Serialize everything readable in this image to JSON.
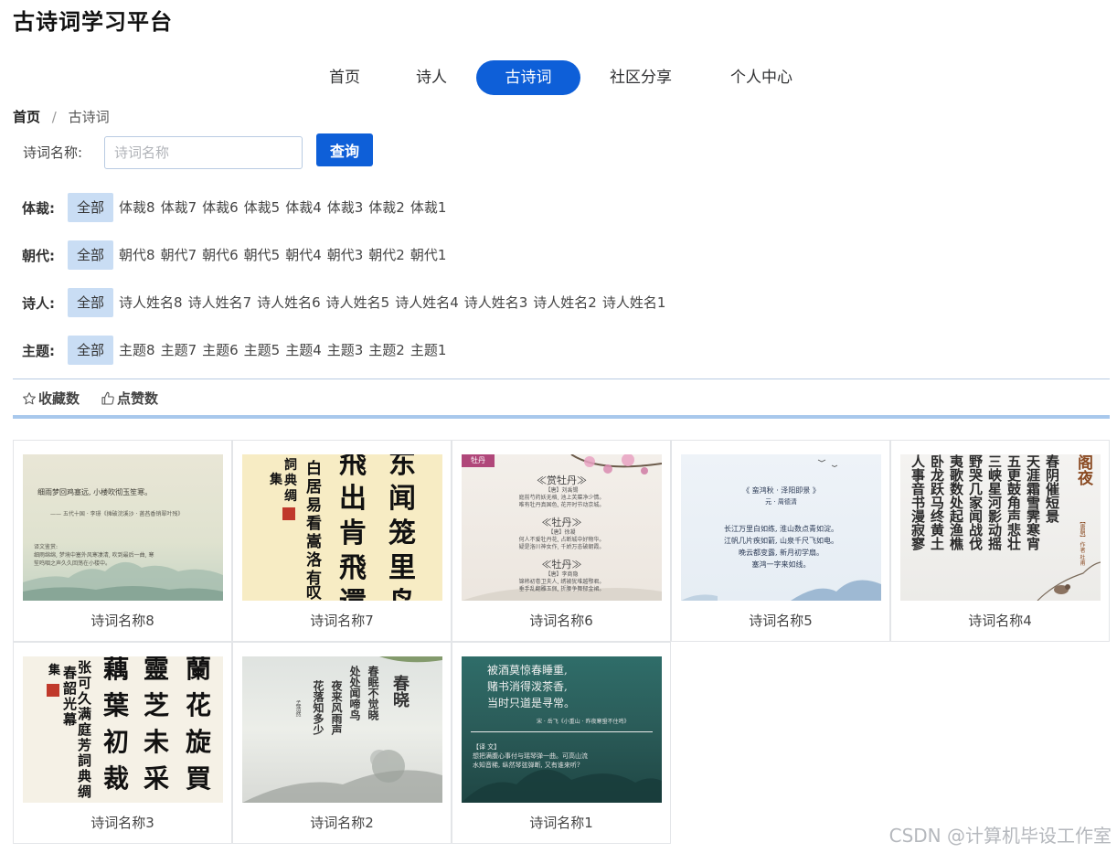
{
  "site": {
    "title": "古诗词学习平台"
  },
  "nav": {
    "items": [
      "首页",
      "诗人",
      "古诗词",
      "社区分享",
      "个人中心"
    ],
    "active_index": 2
  },
  "breadcrumb": {
    "home": "首页",
    "separator": "/",
    "current": "古诗词"
  },
  "search": {
    "label": "诗词名称:",
    "placeholder": "诗词名称",
    "value": "",
    "button": "查询"
  },
  "filters": [
    {
      "label": "体裁:",
      "options": [
        "全部",
        "体裁8",
        "体裁7",
        "体裁6",
        "体裁5",
        "体裁4",
        "体裁3",
        "体裁2",
        "体裁1"
      ],
      "selected": "全部"
    },
    {
      "label": "朝代:",
      "options": [
        "全部",
        "朝代8",
        "朝代7",
        "朝代6",
        "朝代5",
        "朝代4",
        "朝代3",
        "朝代2",
        "朝代1"
      ],
      "selected": "全部"
    },
    {
      "label": "诗人:",
      "options": [
        "全部",
        "诗人姓名8",
        "诗人姓名7",
        "诗人姓名6",
        "诗人姓名5",
        "诗人姓名4",
        "诗人姓名3",
        "诗人姓名2",
        "诗人姓名1"
      ],
      "selected": "全部"
    },
    {
      "label": "主题:",
      "options": [
        "全部",
        "主题8",
        "主题7",
        "主题6",
        "主题5",
        "主题4",
        "主题3",
        "主题2",
        "主题1"
      ],
      "selected": "全部"
    }
  ],
  "sort": {
    "favorites": "收藏数",
    "likes": "点赞数"
  },
  "poems": [
    {
      "name": "诗词名称8",
      "img": {
        "lines": [
          "细雨梦回鸡塞远, 小楼吹彻玉笙寒。",
          "—— 五代十国 · 李璟《摊破浣溪沙 · 菡萏香销翠叶残》",
          "译文鉴赏:",
          "细雨绵绵, 梦境中塞外风寒凄清, 吹到最后一曲, 寒",
          "笙鸣咽之声久久回荡在小楼中。"
        ]
      }
    },
    {
      "name": "诗词名称7",
      "img": {
        "lines": [
          "东",
          "闻",
          "笼",
          "里",
          "鸟",
          "飛",
          "出",
          "肯",
          "飛",
          "還",
          "白",
          "居",
          "易",
          "看",
          "嵩",
          "洛",
          "有",
          "叹",
          "詞",
          "典",
          "绸",
          "集"
        ]
      }
    },
    {
      "name": "诗词名称6",
      "img": {
        "tag": "牡丹",
        "blocks": [
          {
            "title": "≪赏牡丹≫",
            "author": "【唐】刘禹锡",
            "lines": [
              "庭前芍药妖无格, 池上芙蕖净少情。",
              "唯有牡丹真国色, 花开时节动京城。"
            ]
          },
          {
            "title": "≪牡丹≫",
            "author": "【唐】徐凝",
            "lines": [
              "何人不爱牡丹花, 占断城中好物华。",
              "疑是洛川神女作, 千娇万态破朝霞。"
            ]
          },
          {
            "title": "≪牡丹≫",
            "author": "【唐】李商隐",
            "lines": [
              "锦帏初卷卫夫人, 绣被犹堆越鄂君。",
              "垂手乱翻雕玉佩, 折腰争舞郁金裙。"
            ]
          }
        ]
      }
    },
    {
      "name": "诗词名称5",
      "img": {
        "title": "《 蛮鸿秋 · 泽阳即景 》",
        "author": "元 · 周德清",
        "lines": [
          "长江万里白如练, 淮山数点青如淀。",
          "江帆几片疾如箭, 山泉千尺飞如电。",
          "晚云都变露, 新月初学扇。",
          "塞鸿一字来如线。"
        ]
      }
    },
    {
      "name": "诗词名称4",
      "img": {
        "columns": [
          "春阴催短景",
          "天涯霜雪霁寒宵",
          "五更鼓角声悲壮",
          "三峡星河影动摇",
          "野哭几家闻战伐",
          "夷歌数处起渔樵",
          "卧龙跃马终黄土",
          "人事音书漫寂寥"
        ],
        "title": "阁夜",
        "seal": "【唐朝】 作者 杜甫"
      }
    },
    {
      "name": "诗词名称3",
      "img": {
        "lines": [
          "蘭",
          "花",
          "旋",
          "買",
          "靈",
          "芝",
          "未",
          "采",
          "藕",
          "葉",
          "初",
          "裁",
          "张",
          "可",
          "久",
          "满",
          "庭",
          "芳",
          "春",
          "韶",
          "光",
          "幕",
          "詞",
          "典",
          "绸",
          "集"
        ]
      }
    },
    {
      "name": "诗词名称2",
      "img": {
        "title": "春晓",
        "columns": [
          "春眠不觉晓",
          "处处闻啼鸟",
          "夜来风雨声",
          "花落知多少"
        ],
        "author": "孟浩然"
      }
    },
    {
      "name": "诗词名称1",
      "img": {
        "lines": [
          "被酒莫惊春睡重,",
          "赌书消得泼茶香,",
          "当时只道是寻常。"
        ],
        "attribution": "宋 · 岳飞《小重山 · 昨夜寒蛩不住鸣》",
        "note_title": "【译 文】",
        "note_lines": [
          "想把满腹心事付与瑶琴弹一曲。可高山流",
          "水知音稀, 纵然琴弦弹断, 又有谁来听?"
        ]
      }
    }
  ],
  "watermark": "CSDN @计算机毕设工作室",
  "colors": {
    "primary": "#0e5fd8",
    "filter_active_bg": "#c9ddf4",
    "divider": "#a8c8ec"
  }
}
